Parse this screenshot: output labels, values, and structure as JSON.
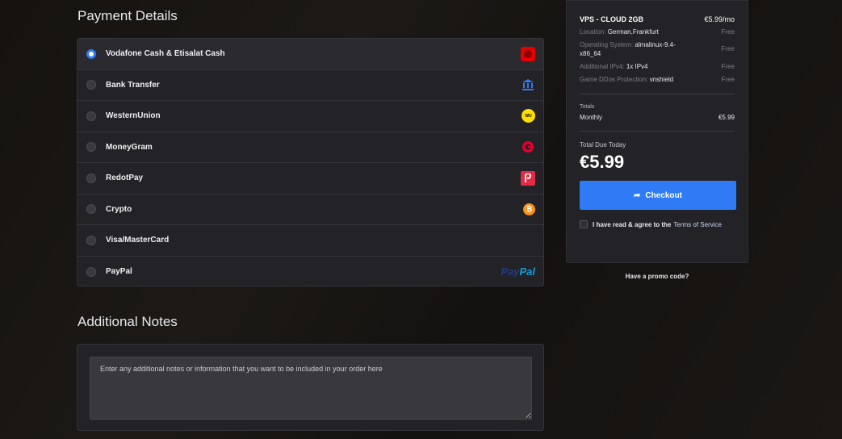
{
  "payment": {
    "title": "Payment Details",
    "methods": [
      {
        "label": "Vodafone Cash & Etisalat Cash",
        "icon": "vodafone-icon",
        "selected": true
      },
      {
        "label": "Bank Transfer",
        "icon": "bank-icon",
        "selected": false
      },
      {
        "label": "WesternUnion",
        "icon": "western-union-icon",
        "selected": false
      },
      {
        "label": "MoneyGram",
        "icon": "moneygram-icon",
        "selected": false
      },
      {
        "label": "RedotPay",
        "icon": "redotpay-icon",
        "selected": false
      },
      {
        "label": "Crypto",
        "icon": "bitcoin-icon",
        "selected": false
      },
      {
        "label": "Visa/MasterCard",
        "icon": "",
        "selected": false
      },
      {
        "label": "PayPal",
        "icon": "paypal-logo",
        "selected": false
      }
    ],
    "paypal_logo_part1": "Pay",
    "paypal_logo_part2": "Pal",
    "wu_logo_text": "WU"
  },
  "notes": {
    "title": "Additional Notes",
    "placeholder": "Enter any additional notes or information that you want to be included in your order here"
  },
  "summary": {
    "product": "VPS - CLOUD 2GB",
    "product_price": "€5.99/mo",
    "lines": [
      {
        "key": "Location:",
        "value": "German,Frankfurt",
        "price": "Free"
      },
      {
        "key": "Operating System:",
        "value": "almalinux-9.4-x86_64",
        "price": "Free"
      },
      {
        "key": "Additional IPv4:",
        "value": "1x IPv4",
        "price": "Free"
      },
      {
        "key": "Game DDos Protection:",
        "value": "vnshield",
        "price": "Free"
      }
    ],
    "totals_label": "Totals",
    "monthly_label": "Monthly",
    "monthly_value": "€5.99",
    "due_label": "Total Due Today",
    "due_amount": "€5.99",
    "checkout_label": "Checkout",
    "tos_text": "I have read & agree to the",
    "tos_link": "Terms of Service",
    "promo": "Have a promo code?"
  },
  "colors": {
    "accent": "#2f7bf5",
    "panel": "#232327"
  }
}
